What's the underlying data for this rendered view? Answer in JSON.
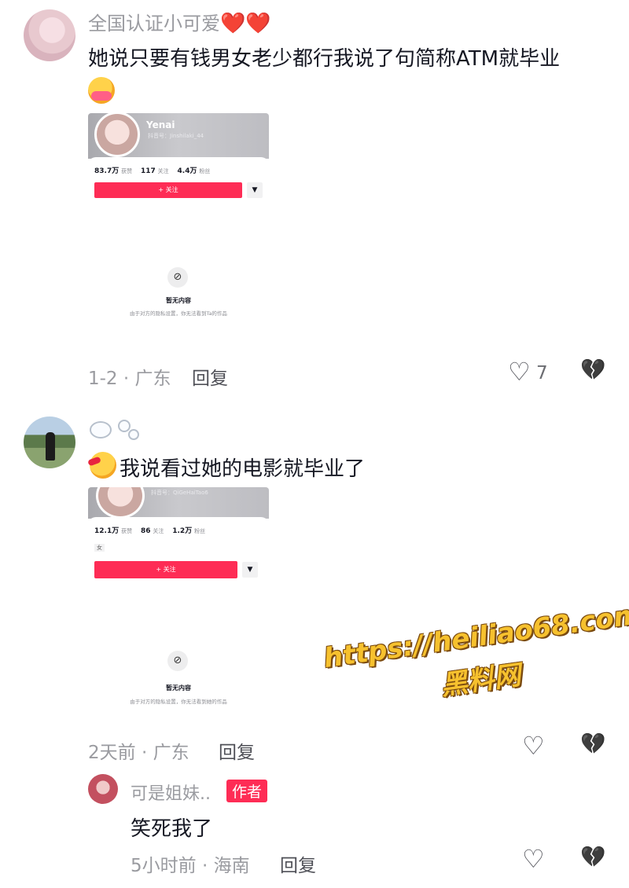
{
  "comments": [
    {
      "username": "全国认证小可爱",
      "username_hearts": "❤️❤️",
      "text": "她说只要有钱男女老少都行我说了句简称ATM就毕业",
      "meta": "1-2 · 广东",
      "reply_label": "回复",
      "like_count": "7",
      "screenshot": {
        "name": "Yenai",
        "id_text": "抖音号：Jinshilaki_44",
        "stats": [
          {
            "value": "83.7万",
            "label": "获赞"
          },
          {
            "value": "117",
            "label": "关注"
          },
          {
            "value": "4.4万",
            "label": "粉丝"
          }
        ],
        "follow_label": "+ 关注",
        "dropdown_glyph": "▼",
        "empty_title": "暂无内容",
        "empty_desc": "由于对方的隐私设置，你无法看到Ta的作品"
      }
    },
    {
      "username": "",
      "text": "我说看过她的电影就毕业了",
      "meta": "2天前 · 广东",
      "reply_label": "回复",
      "screenshot": {
        "id_text": "抖音号：QiGeHaiTao6",
        "stats": [
          {
            "value": "12.1万",
            "label": "获赞"
          },
          {
            "value": "86",
            "label": "关注"
          },
          {
            "value": "1.2万",
            "label": "粉丝"
          }
        ],
        "tag": "女",
        "follow_label": "+ 关注",
        "dropdown_glyph": "▼",
        "empty_title": "暂无内容",
        "empty_desc": "由于对方的隐私设置，你无法看到她的作品"
      }
    },
    {
      "username": "可是姐妹..",
      "author_badge": "作者",
      "text": "笑死我了",
      "meta": "5小时前 · 海南",
      "reply_label": "回复"
    }
  ],
  "icons": {
    "like": "heart-outline-icon",
    "dislike": "broken-heart-icon",
    "like_glyph": "♡",
    "dislike_glyph": "💔"
  },
  "watermark": {
    "url": "https://heiliao68.com",
    "name": "黑料网"
  },
  "colors": {
    "accent": "#fe2c55",
    "meta_text": "#9a9ba0",
    "watermark": "#f6c12e"
  }
}
